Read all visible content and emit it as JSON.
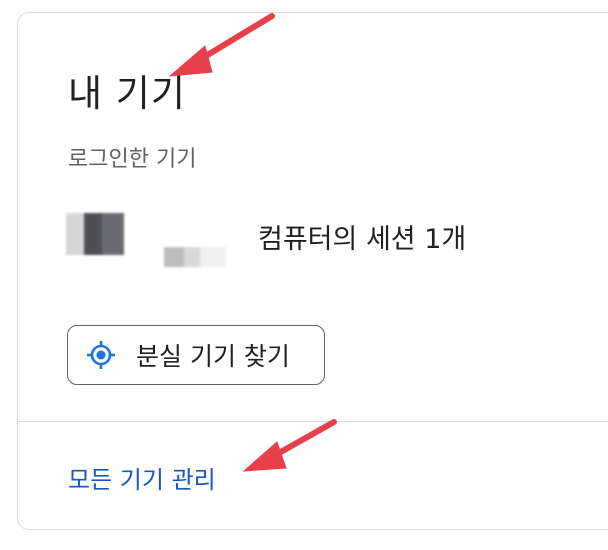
{
  "card": {
    "title": "내 기기",
    "subtitle": "로그인한 기기",
    "device": {
      "description": "컴퓨터의 세션 1개"
    },
    "find_button": {
      "label": "분실 기기 찾기",
      "icon": "location-target-icon"
    },
    "manage_link": "모든 기기 관리"
  },
  "colors": {
    "accent": "#1a73e8",
    "link": "#1a56c0",
    "annotation_arrow": "#e8404a"
  }
}
